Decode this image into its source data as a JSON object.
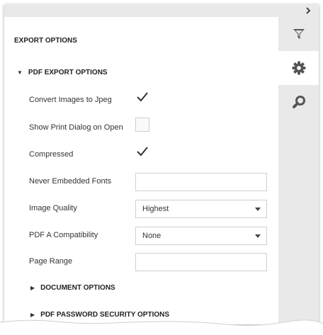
{
  "panel": {
    "title": "EXPORT OPTIONS"
  },
  "side_tabs": [
    {
      "icon": "filter-icon",
      "active": false
    },
    {
      "icon": "gear-icon",
      "active": true
    },
    {
      "icon": "search-icon",
      "active": false
    }
  ],
  "pdf_section": {
    "label": "PDF EXPORT OPTIONS",
    "expanded": true,
    "fields": {
      "convert_images": {
        "label": "Convert Images to Jpeg",
        "checked": true
      },
      "show_print_dialog": {
        "label": "Show Print Dialog on Open",
        "checked": false
      },
      "compressed": {
        "label": "Compressed",
        "checked": true
      },
      "never_embedded_fonts": {
        "label": "Never Embedded Fonts",
        "value": ""
      },
      "image_quality": {
        "label": "Image Quality",
        "value": "Highest"
      },
      "pdfa_compatibility": {
        "label": "PDF A Compatibility",
        "value": "None"
      },
      "page_range": {
        "label": "Page Range",
        "value": ""
      }
    }
  },
  "document_section": {
    "label": "DOCUMENT OPTIONS",
    "expanded": false
  },
  "security_section": {
    "label": "PDF PASSWORD SECURITY OPTIONS",
    "expanded": false
  },
  "colors": {
    "active_tab": "#ffffff",
    "tab_bar": "#e9e9e9",
    "icon": "#555555",
    "check": "#333333"
  }
}
